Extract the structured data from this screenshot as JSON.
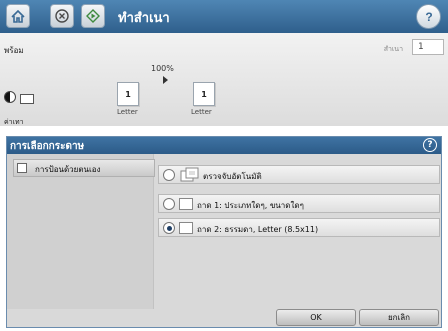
{
  "titlebar": {
    "title": "ทำสำเนา",
    "home_icon": "home-icon",
    "stop_icon": "stop-icon",
    "start_icon": "start-icon",
    "help_icon": "help-icon"
  },
  "copy_panel": {
    "status": "พร้อม",
    "copies_label": "สำเนา",
    "copies_value": "1",
    "zoom": "100%",
    "original_pages": "1",
    "original_size": "Letter",
    "output_pages": "1",
    "output_size": "Letter",
    "contrast_label": "ค่าเทา"
  },
  "dialog": {
    "title": "การเลือกกระดาษ",
    "manual_feed_label": "การป้อนด้วยตนเอง",
    "options": [
      {
        "label": "ตรวจจับอัตโนมัติ",
        "selected": false
      },
      {
        "label": "ถาด 1: ประเภทใดๆ, ขนาดใดๆ",
        "selected": false
      },
      {
        "label": "ถาด 2: ธรรมดา, Letter (8.5x11)",
        "selected": true
      }
    ],
    "ok_label": "OK",
    "cancel_label": "ยกเลิก"
  },
  "colors": {
    "titlebar_top": "#4f86b4",
    "titlebar_bottom": "#2f5f8c",
    "dialog_header": "#3f73a3"
  }
}
